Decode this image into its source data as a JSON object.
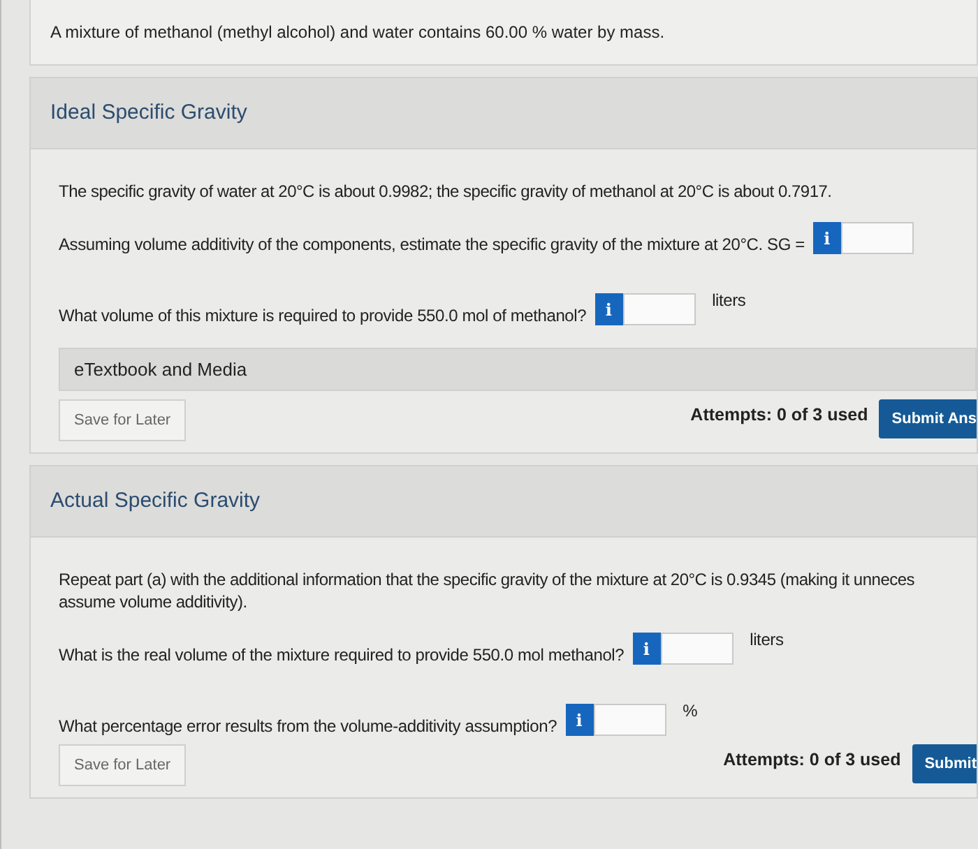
{
  "intro": "A mixture of methanol (methyl alcohol) and water contains 60.00 % water by mass.",
  "parts": [
    {
      "title": "Ideal Specific Gravity",
      "items": [
        {
          "kind": "text",
          "lines": [
            "The specific gravity of water at 20°C is about 0.9982; the specific gravity of methanol at 20°C is about 0.7917."
          ]
        },
        {
          "kind": "question",
          "text": "Assuming volume additivity of the components, estimate the specific gravity of the mixture at 20°C. SG =",
          "hint": "i"
        },
        {
          "kind": "question",
          "text": "What volume of this mixture is required to provide 550.0 mol of methanol?",
          "hint": "i",
          "unit": "liters"
        }
      ],
      "media": "eTextbook and Media",
      "save": "Save for Later",
      "attempts": "Attempts: 0 of 3 used",
      "submit": "Submit Ans"
    },
    {
      "title": "Actual Specific Gravity",
      "items": [
        {
          "kind": "text",
          "lines": [
            "Repeat part (a) with the additional information that the specific gravity of the mixture at 20°C is 0.9345 (making it unneces",
            "assume volume additivity)."
          ]
        },
        {
          "kind": "question",
          "text": "What is the real volume of the mixture required to provide 550.0 mol methanol?",
          "hint": "i",
          "unit": "liters"
        },
        {
          "kind": "question",
          "text": "What percentage error results from the volume-additivity assumption?",
          "hint": "i",
          "unit": "%"
        }
      ],
      "save": "Save for Later",
      "attempts": "Attempts: 0 of 3 used",
      "submit": "Submit"
    }
  ]
}
